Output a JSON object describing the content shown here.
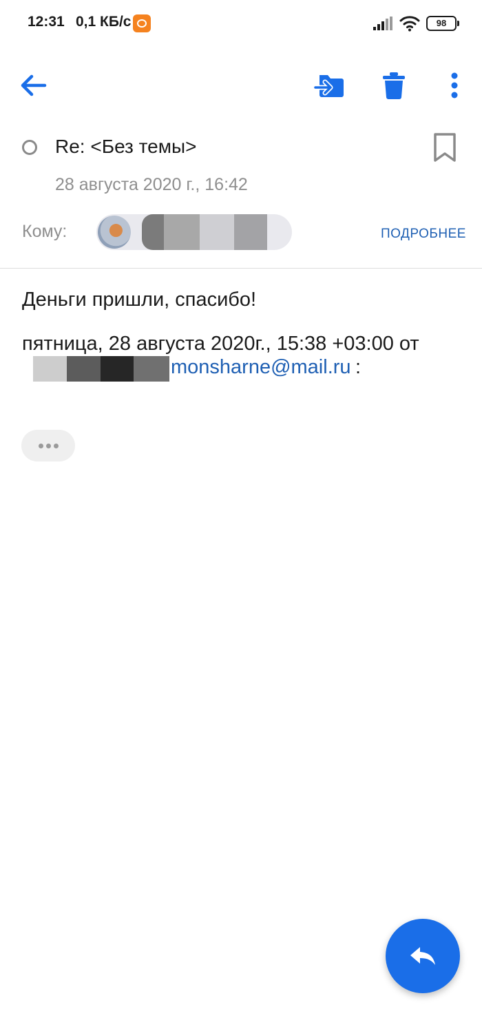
{
  "status_bar": {
    "time": "12:31",
    "network_speed": "0,1 КБ/с",
    "battery": "98",
    "icons": [
      "app-notification-icon",
      "signal-icon",
      "wifi-icon",
      "battery-icon"
    ]
  },
  "toolbar": {
    "icons": [
      "back-arrow-icon",
      "move-to-folder-icon",
      "trash-icon",
      "more-vert-icon"
    ],
    "accent_color": "#1a6ee8"
  },
  "message": {
    "subject": "Re: <Без темы>",
    "date": "28 августа 2020 г., 16:42",
    "to_label": "Кому:",
    "details_label": "ПОДРОБНЕЕ",
    "body": "Деньги пришли, спасибо!",
    "quote_header": "пятница, 28 августа 2020г., 15:38 +03:00 от",
    "quote_email": "monsharne@mail.ru",
    "quote_colon": ":"
  },
  "fab": {
    "icon": "reply-icon",
    "color": "#1a6ee8"
  }
}
